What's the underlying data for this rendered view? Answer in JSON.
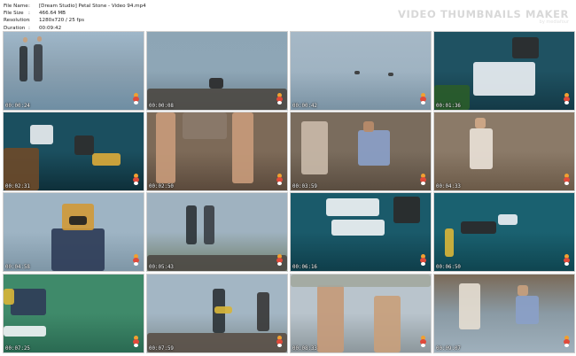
{
  "header": {
    "file_name_key": "File Name",
    "file_name": "[Dream Studio] Petal Stone - Video 94.mp4",
    "file_size_key": "File Size",
    "file_size": "466.64 MB",
    "resolution_key": "Resolution",
    "resolution": "1280x720 / 25 fps",
    "duration_key": "Duration",
    "duration": "00:09:42",
    "sep": ":"
  },
  "brand": {
    "title": "VIDEO THUMBNAILS MAKER",
    "subtitle": "by mediafour"
  },
  "thumbnails": [
    {
      "time": "00:00:24",
      "scene": "underwater-divers"
    },
    {
      "time": "00:00:08",
      "scene": "swimmer-rocky-shore"
    },
    {
      "time": "00:00:42",
      "scene": "swimmers-in-sea"
    },
    {
      "time": "00:01:36",
      "scene": "diver-with-camera-rig"
    },
    {
      "time": "00:02:31",
      "scene": "diver-coral-camera"
    },
    {
      "time": "00:02:50",
      "scene": "legs-on-rocks"
    },
    {
      "time": "00:03:59",
      "scene": "people-on-rocks"
    },
    {
      "time": "00:04:33",
      "scene": "woman-kneeling-rocks"
    },
    {
      "time": "00:04:58",
      "scene": "child-with-mask"
    },
    {
      "time": "00:05:43",
      "scene": "children-on-shore"
    },
    {
      "time": "00:06:16",
      "scene": "underwater-camera-rig"
    },
    {
      "time": "00:06:50",
      "scene": "underwater-diver-tank"
    },
    {
      "time": "00:07:25",
      "scene": "divers-green-water"
    },
    {
      "time": "00:07:59",
      "scene": "children-rocky-shore"
    },
    {
      "time": "00:08:33",
      "scene": "boys-by-sea"
    },
    {
      "time": "00:09:07",
      "scene": "kids-on-rocks"
    }
  ]
}
